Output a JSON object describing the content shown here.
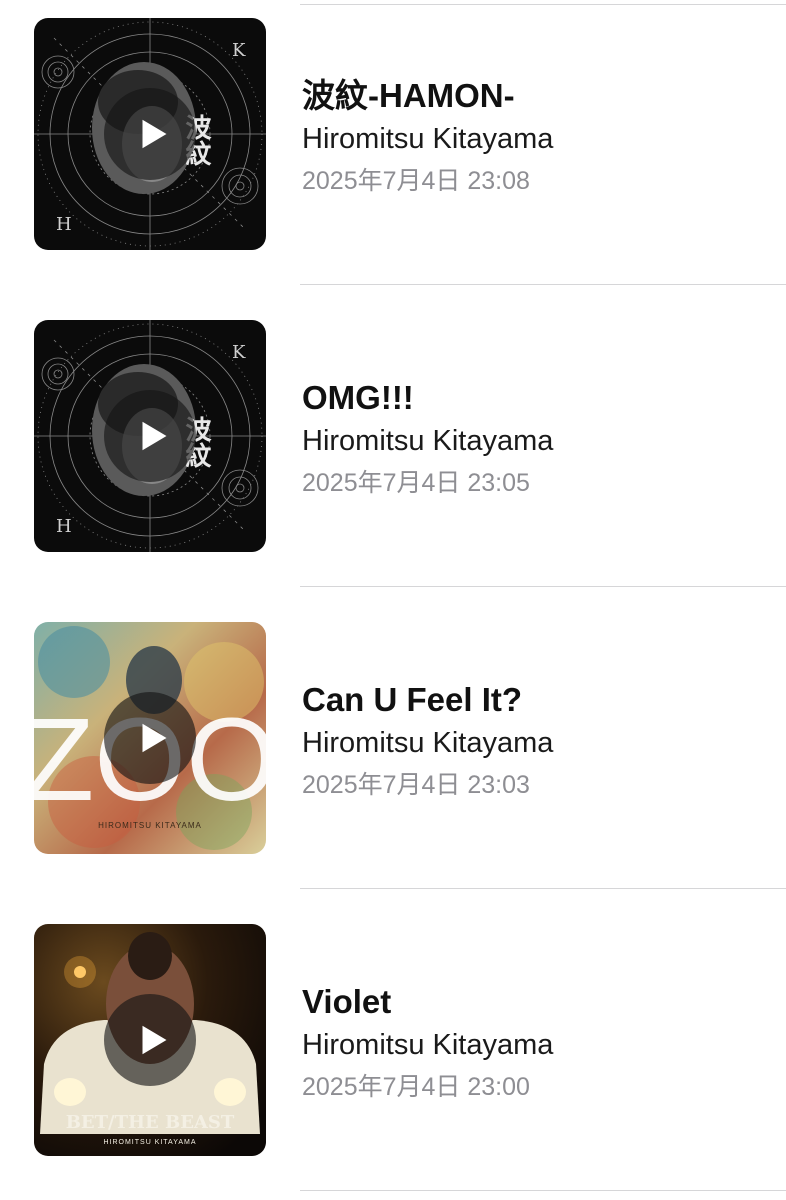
{
  "tracks": [
    {
      "title": "波紋-HAMON-",
      "artist": "Hiromitsu Kitayama",
      "date": "2025年7月4日 23:08",
      "artwork": "hamon-cover",
      "artwork_text": "波紋",
      "artwork_letters": [
        "K",
        "H"
      ]
    },
    {
      "title": "OMG!!!",
      "artist": "Hiromitsu Kitayama",
      "date": "2025年7月4日 23:05",
      "artwork": "hamon-cover",
      "artwork_text": "波紋",
      "artwork_letters": [
        "K",
        "H"
      ]
    },
    {
      "title": "Can U Feel It?",
      "artist": "Hiromitsu Kitayama",
      "date": "2025年7月4日 23:03",
      "artwork": "zoo-cover",
      "artwork_text": "ZOO",
      "artwork_caption": "HIROMITSU KITAYAMA"
    },
    {
      "title": "Violet",
      "artist": "Hiromitsu Kitayama",
      "date": "2025年7月4日 23:00",
      "artwork": "bet-the-beast-cover",
      "artwork_text": "BET/THE BEAST",
      "artwork_caption": "HIROMITSU KITAYAMA"
    }
  ],
  "icons": {
    "play": "play-icon"
  },
  "colors": {
    "title": "#111111",
    "artist": "#1a1a1a",
    "date": "#8e8e93",
    "divider": "#d6d6d8"
  }
}
